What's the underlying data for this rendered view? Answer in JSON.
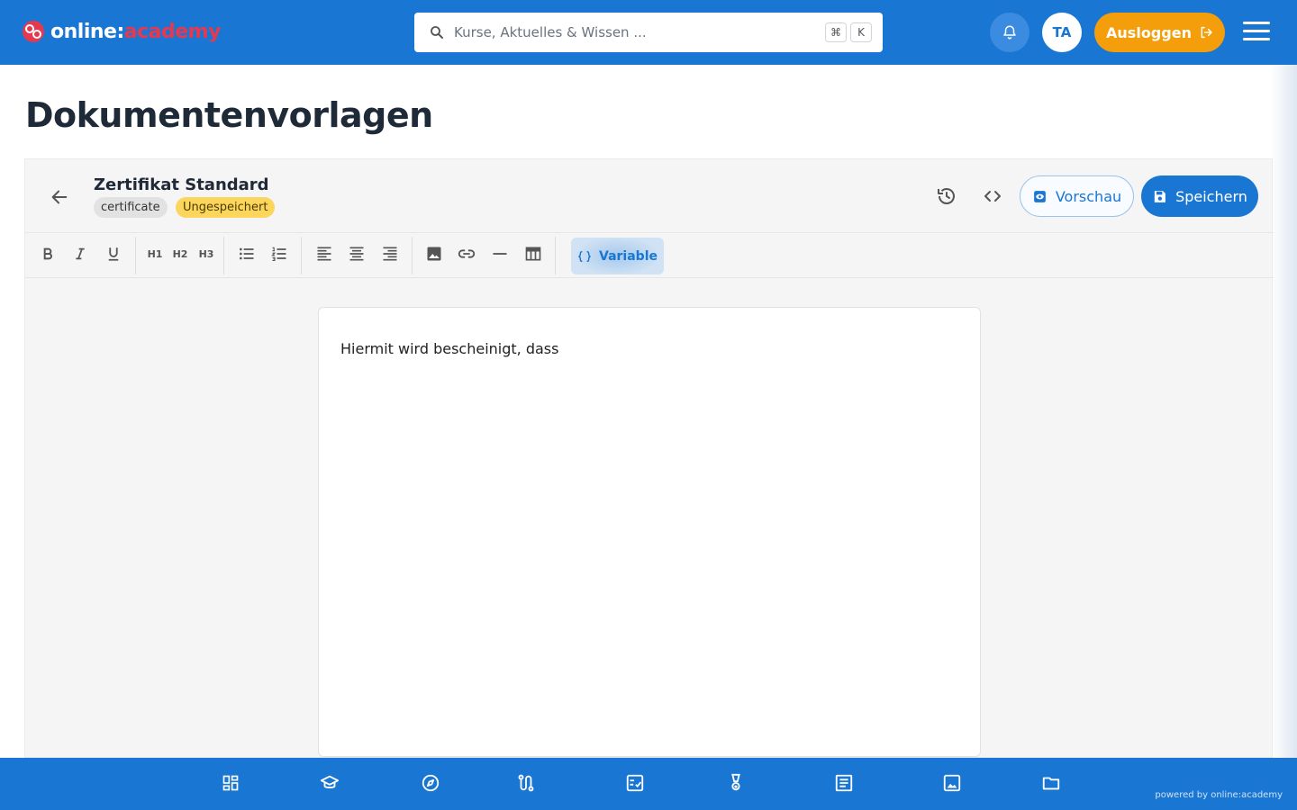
{
  "header": {
    "logo_primary": "online:",
    "logo_accent": "academy",
    "search_placeholder": "Kurse, Aktuelles & Wissen ...",
    "shortcut_modifier": "⌘",
    "shortcut_key": "K",
    "avatar_initials": "TA",
    "logout_label": "Ausloggen",
    "icons": [
      "logo-icon",
      "search-icon",
      "bell-icon",
      "logout-icon",
      "menu-icon"
    ]
  },
  "page": {
    "title": "Dokumentenvorlagen"
  },
  "editor": {
    "document_name": "Zertifikat Standard",
    "type_chip": "certificate",
    "status_chip": "Ungespeichert",
    "preview_label": "Vorschau",
    "save_label": "Speichern",
    "variable_label": "Variable",
    "toolbar": {
      "h1": "H1",
      "h2": "H2",
      "h3": "H3",
      "buttons": [
        "bold",
        "italic",
        "underline",
        "heading-1",
        "heading-2",
        "heading-3",
        "bullet-list",
        "numbered-list",
        "align-left",
        "align-center",
        "align-right",
        "image",
        "link",
        "horizontal-rule",
        "table",
        "variable"
      ]
    },
    "content": "Hiermit wird bescheinigt, dass"
  },
  "bottom_nav": {
    "items": [
      "dashboard",
      "courses",
      "explore",
      "learning-paths",
      "tasks",
      "awards",
      "articles",
      "media",
      "files"
    ],
    "powered_by": "powered by online:academy"
  },
  "colors": {
    "primary": "#1976d2",
    "logout": "#f59e0b",
    "logo_accent": "#e53950",
    "status_chip": "#fcd55c"
  }
}
